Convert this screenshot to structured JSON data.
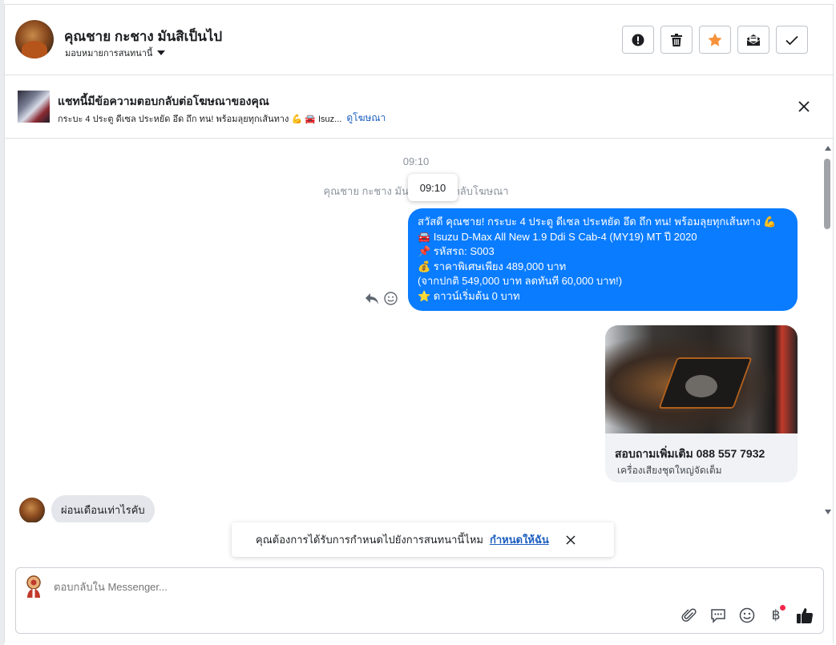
{
  "header": {
    "contact_name": "คุณชาย กะชาง มันสิเป็นไป",
    "assign_label": "มอบหมายการสนทนานี้",
    "actions": [
      "exclamation-icon",
      "trash-icon",
      "star-icon",
      "mail-icon",
      "check-icon"
    ],
    "star_color": "#f7923b"
  },
  "ad": {
    "title": "แชทนี้มีข้อความตอบกลับต่อโฆษณาของคุณ",
    "subtitle": "กระบะ 4 ประตู ดีเซล ประหยัด อึด ถึก ทน! พร้อมลุยทุกเส้นทาง 💪 🚘 Isuz...",
    "link": "ดูโฆษณา"
  },
  "chat": {
    "timestamp": "09:10",
    "system_text": "คุณชาย กะชาง มันสิเป็...ตอบกลับโฆษณา",
    "tooltip": "09:10",
    "outgoing_lines": [
      "สวัสดี คุณชาย! กระบะ 4 ประตู ดีเซล ประหยัด อึด ถึก ทน! พร้อมลุยทุกเส้นทาง 💪",
      "🚘 Isuzu D-Max All New 1.9 Ddi S Cab-4 (MY19) MT ปี 2020",
      "📌 รหัสรถ: S003",
      "💰 ราคาพิเศษเพียง 489,000 บาท",
      "(จากปกติ 549,000 บาท ลดทันที 60,000 บาท!)",
      "⭐ ดาวน์เริ่มต้น 0 บาท"
    ],
    "card_title": "สอบถามเพิ่มเติม 088 557 7932",
    "card_subtitle": "เครื่องเสียงชุดใหญ่จัดเต็ม",
    "incoming_text": "ผ่อนเดือนเท่าไรคับ",
    "bubble_color": "#0a7cff"
  },
  "notification": {
    "text": "คุณต้องการได้รับการกำหนดไปยังการสนทนานี้ไหม",
    "link": "กำหนดให้ฉัน"
  },
  "composer": {
    "placeholder": "ตอบกลับใน Messenger...",
    "tools": [
      "paperclip-icon",
      "saved-reply-icon",
      "emoji-icon",
      "baht-icon",
      "thumbs-up-icon"
    ],
    "baht_symbol": "฿"
  }
}
